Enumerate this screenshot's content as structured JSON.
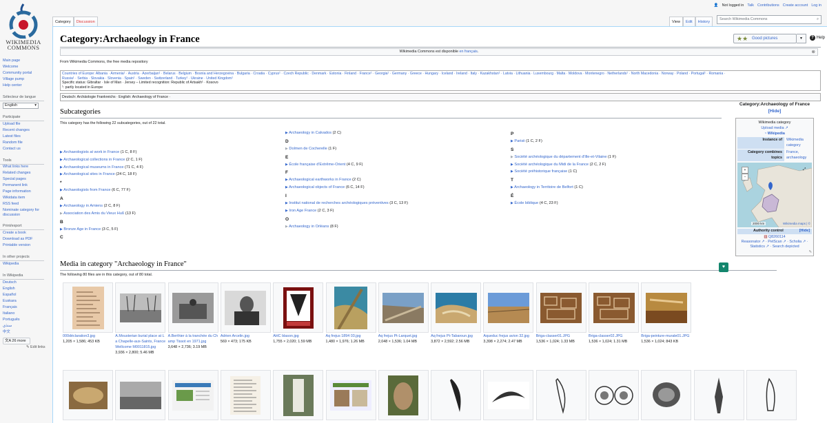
{
  "site": {
    "logo_text_1": "WIKIMEDIA",
    "logo_text_2": "COMMONS"
  },
  "personal": {
    "not_logged": "Not logged in",
    "talk": "Talk",
    "contributions": "Contributions",
    "create": "Create account",
    "login": "Log in"
  },
  "tabs": {
    "category": "Category",
    "discussion": "Discussion",
    "view": "View",
    "edit": "Edit",
    "history": "History"
  },
  "search": {
    "placeholder": "Search Wikimedia Commons"
  },
  "sidebar": {
    "nav": [
      "Main page",
      "Welcome",
      "Community portal",
      "Village pump",
      "Help center"
    ],
    "lang_heading": "Sélecteur de langue",
    "lang_value": "English",
    "participate_heading": "Participate",
    "participate": [
      "Upload file",
      "Recent changes",
      "Latest files",
      "Random file",
      "Contact us"
    ],
    "tools_heading": "Tools",
    "tools": [
      "What links here",
      "Related changes",
      "Special pages",
      "Permanent link",
      "Page information",
      "Wikidata item",
      "RSS feed",
      "Nominate category for discussion"
    ],
    "print_heading": "Print/export",
    "print": [
      "Create a book",
      "Download as PDF",
      "Printable version"
    ],
    "other_heading": "In other projects",
    "other": [
      "Wikipedia"
    ],
    "wp_heading": "In Wikipedia",
    "wp": [
      "Deutsch",
      "English",
      "Español",
      "Euskara",
      "Français",
      "Italiano",
      "Português",
      "سنڌي",
      "中文"
    ],
    "more": "26 more",
    "edit_links": "Edit links"
  },
  "page": {
    "title": "Category:Archaeology in France",
    "good_pictures": "Good pictures",
    "help": "Help",
    "notice_pre": "Wikimedia Commons est disponible ",
    "notice_link": "en français",
    "notice_post": ".",
    "from": "From Wikimedia Commons, the free media repository"
  },
  "countries": {
    "line1": "Countries of Europe: Albania · Armenia¹ · Austria · Azerbaijan¹ · Belarus · Belgium · Bosnia and Herzegovina · Bulgaria · Croatia · Cyprus¹ · Czech Republic · Denmark · Estonia · Finland · France¹ · Georgia¹ · Germany · Greece · Hungary · Iceland · Ireland · Italy · Kazakhstan¹ · Latvia · Lithuania · Luxembourg · Malta · Moldova · Montenegro · Netherlands¹ · North Macedonia · Norway · Poland · Portugal¹ · Romania ·",
    "line2": "Russia¹ · Serbia · Slovakia · Slovenia · Spain¹ · Sweden · Switzerland · Turkey¹ · Ukraine · United Kingdom¹",
    "line3": "Specific status: Gibraltar · Isle of Man · Jersey – Limited recognition: Republic of Artsakh¹ · Kosovo",
    "line4": "¹: partly located in Europe"
  },
  "translations": "Deutsch: Archäologie Frankreichs · English: Archaeology of France ·",
  "subcats": {
    "heading": "Subcategories",
    "summary": "This category has the following 22 subcategories, out of 22 total.",
    "col1": [
      {
        "h": "",
        "items": []
      },
      {
        "h": "",
        "items": [
          [
            "Archaeologists at work in France",
            "(1 C, 8 F)",
            1
          ],
          [
            "Archaeological collections in France",
            "(2 C, 1 F)",
            1
          ],
          [
            "Archaeological museums in France",
            "(71 C, 4 F)",
            1
          ],
          [
            "Archaeological sites in France",
            "(24 C, 18 F)",
            1
          ]
        ]
      },
      {
        "h": "*",
        "items": [
          [
            "Archaeologists from France",
            "(6 C, 77 F)",
            1
          ]
        ]
      },
      {
        "h": "A",
        "items": [
          [
            "Archaeology in Amiens",
            "(2 C, 8 F)",
            1
          ],
          [
            "Association des Amis du Vieux Huß",
            "(13 F)",
            0
          ]
        ]
      },
      {
        "h": "B",
        "items": [
          [
            "Bronze Age in France",
            "(3 C, 5 F)",
            1
          ]
        ]
      },
      {
        "h": "C",
        "items": []
      }
    ],
    "col2": [
      {
        "h": "",
        "items": [
          [
            "Archaeology in Calvados",
            "(2 C)",
            1
          ]
        ]
      },
      {
        "h": "D",
        "items": [
          [
            "Dolmen de Cocherelle",
            "(1 F)",
            0
          ]
        ]
      },
      {
        "h": "E",
        "items": [
          [
            "École française d'Extrême-Orient",
            "(4 C, 9 F)",
            1
          ]
        ]
      },
      {
        "h": "F",
        "items": [
          [
            "Archaeological earthworks in France",
            "(2 C)",
            1
          ],
          [
            "Archaeological objects of France",
            "(6 C, 14 F)",
            1
          ]
        ]
      },
      {
        "h": "I",
        "items": [
          [
            "Institut national de recherches archéologiques préventives",
            "(3 C, 13 F)",
            1
          ],
          [
            "Iron Age France",
            "(2 C, 3 F)",
            1
          ]
        ]
      },
      {
        "h": "O",
        "items": [
          [
            "Archaeology in Orléans",
            "(8 F)",
            0
          ]
        ]
      }
    ],
    "col3": [
      {
        "h": "P",
        "items": [
          [
            "Parisii",
            "(1 C, 2 F)",
            1
          ]
        ]
      },
      {
        "h": "S",
        "items": [
          [
            "Société archéologique du département d'Ille-et-Vilaine",
            "(1 F)",
            0
          ],
          [
            "Société archéologique du Midi de la France",
            "(2 C, 2 F)",
            1
          ],
          [
            "Société préhistorique française",
            "(1 C)",
            1
          ]
        ]
      },
      {
        "h": "T",
        "items": [
          [
            "Archaeology in Territoire de Belfort",
            "(1 C)",
            1
          ]
        ]
      },
      {
        "h": "É",
        "items": [
          [
            "École biblique",
            "(4 C, 23 F)",
            1
          ]
        ]
      }
    ]
  },
  "media": {
    "heading": "Media in category \"Archaeology in France\"",
    "summary": "The following 80 files are in this category, out of 80 total.",
    "row1": [
      {
        "name": "000déclaration3.jpg",
        "meta": [
          "1,205 × 1,586; 453 KB"
        ],
        "thumb": "doc"
      },
      {
        "name": "A.Mousterian burial place at La Chapelle-aux-Saints, France Wellcome M0011815.jpg",
        "meta": [
          "3,936 × 2,800; 5.46 MB"
        ],
        "thumb": "bw"
      },
      {
        "name": "A.Berthier à la tranchée du Champ Tissot en 1971.jpg",
        "meta": [
          "3,648 × 2,736; 3.19 MB"
        ],
        "thumb": "bw2"
      },
      {
        "name": "Adrien Arcelin.jpg",
        "meta": [
          "569 × 473; 175 KB"
        ],
        "thumb": "portrait"
      },
      {
        "name": "AHC blason.jpg",
        "meta": [
          "1,755 × 2,020; 1.59 MB"
        ],
        "thumb": "blason"
      },
      {
        "name": "Aq frejus 1894 03.jpg",
        "meta": [
          "1,480 × 1,976; 1.26 MB"
        ],
        "thumb": "aq"
      },
      {
        "name": "Aq frejus Pt-Larquet.jpg",
        "meta": [
          "2,048 × 1,536; 1.04 MB"
        ],
        "thumb": "aerial"
      },
      {
        "name": "Aq frejus Pt-Tabaroun.jpg",
        "meta": [
          "3,872 × 2,592; 2.56 MB"
        ],
        "thumb": "bay"
      },
      {
        "name": "Aqueduc frejus avion 32.jpg",
        "meta": [
          "3,398 × 2,274; 2.47 MB"
        ],
        "thumb": "sky"
      },
      {
        "name": "Briga-classer01.JPG",
        "meta": [
          "1,536 × 1,024; 1.33 MB"
        ],
        "thumb": "ruin"
      },
      {
        "name": "Briga-classer02.JPG",
        "meta": [
          "1,536 × 1,024; 1.31 MB"
        ],
        "thumb": "ruin"
      },
      {
        "name": "Briga-peinture-murale01.JPG",
        "meta": [
          "1,536 × 1,024; 843 KB"
        ],
        "thumb": "paint"
      }
    ],
    "row2": [
      "stone",
      "bw3",
      "panel",
      "letter",
      "stele",
      "panel2",
      "rock",
      "tooth",
      "fossil",
      "sketch",
      "coin",
      "shell",
      "point",
      "scratch"
    ]
  }
}
